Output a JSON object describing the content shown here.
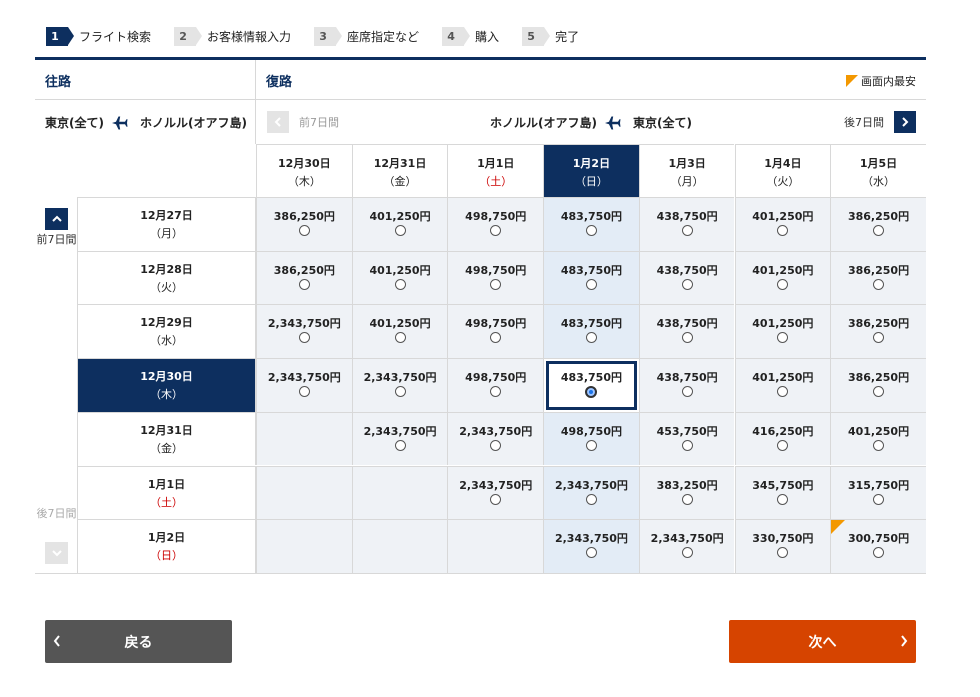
{
  "steps": [
    {
      "num": "1",
      "label": "フライト検索"
    },
    {
      "num": "2",
      "label": "お客様情報入力"
    },
    {
      "num": "3",
      "label": "座席指定など"
    },
    {
      "num": "4",
      "label": "購入"
    },
    {
      "num": "5",
      "label": "完了"
    }
  ],
  "outbound": {
    "title": "往路",
    "from": "東京(全て)",
    "to": "ホノルル(オアフ島)",
    "prev_label": "前7日間",
    "next_label": "後7日間"
  },
  "return": {
    "title": "復路",
    "from": "ホノルル(オアフ島)",
    "to": "東京(全て)",
    "prev_label": "前7日間",
    "next_label": "後7日間"
  },
  "legend_label": "画面内最安",
  "colors": {
    "navy": "#0d2f5f",
    "orange": "#f39800",
    "next": "#d64400",
    "back": "#555555"
  },
  "return_dates": [
    {
      "date": "12月30日",
      "dow": "（木）"
    },
    {
      "date": "12月31日",
      "dow": "（金）"
    },
    {
      "date": "1月1日",
      "dow": "（土）"
    },
    {
      "date": "1月2日",
      "dow": "（日）"
    },
    {
      "date": "1月3日",
      "dow": "（月）"
    },
    {
      "date": "1月4日",
      "dow": "（火）"
    },
    {
      "date": "1月5日",
      "dow": "（水）"
    }
  ],
  "outbound_dates": [
    {
      "date": "12月27日",
      "dow": "（月）"
    },
    {
      "date": "12月28日",
      "dow": "（火）"
    },
    {
      "date": "12月29日",
      "dow": "（水）"
    },
    {
      "date": "12月30日",
      "dow": "（木）"
    },
    {
      "date": "12月31日",
      "dow": "（金）"
    },
    {
      "date": "1月1日",
      "dow": "（土）"
    },
    {
      "date": "1月2日",
      "dow": "（日）"
    }
  ],
  "fares": [
    [
      "386,250円",
      "401,250円",
      "498,750円",
      "483,750円",
      "438,750円",
      "401,250円",
      "386,250円"
    ],
    [
      "386,250円",
      "401,250円",
      "498,750円",
      "483,750円",
      "438,750円",
      "401,250円",
      "386,250円"
    ],
    [
      "2,343,750円",
      "401,250円",
      "498,750円",
      "483,750円",
      "438,750円",
      "401,250円",
      "386,250円"
    ],
    [
      "2,343,750円",
      "2,343,750円",
      "498,750円",
      "483,750円",
      "438,750円",
      "401,250円",
      "386,250円"
    ],
    [
      "",
      "2,343,750円",
      "2,343,750円",
      "498,750円",
      "453,750円",
      "416,250円",
      "401,250円"
    ],
    [
      "",
      "",
      "2,343,750円",
      "2,343,750円",
      "383,250円",
      "345,750円",
      "315,750円"
    ],
    [
      "",
      "",
      "",
      "2,343,750円",
      "2,343,750円",
      "330,750円",
      "300,750円"
    ]
  ],
  "selected": {
    "row": 3,
    "col": 3
  },
  "cheapest": {
    "row": 6,
    "col": 6
  },
  "buttons": {
    "back": "戻る",
    "next": "次へ"
  }
}
